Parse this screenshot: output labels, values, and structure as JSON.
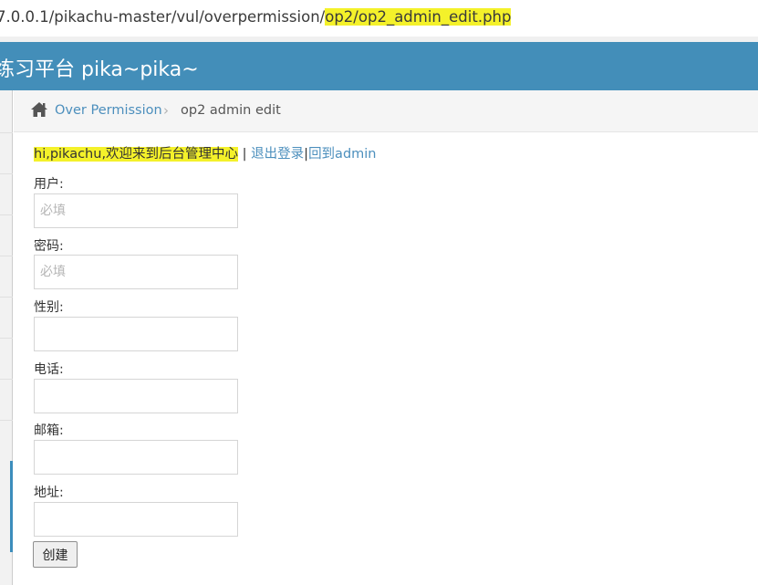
{
  "urlbar": {
    "url_prefix": "7.0.0.1/pikachu-master/vul/overpermission/",
    "url_op2": "op2/",
    "url_file": "op2_admin_edit.php"
  },
  "navbar": {
    "brand": "练习平台 pika~pika~"
  },
  "breadcrumbs": {
    "home_icon": "home-icon",
    "parent": "Over Permission",
    "separator": "›",
    "current": "op2 admin edit"
  },
  "welcome": {
    "greeting": "hi,pikachu,欢迎来到后台管理中心",
    "divider": " | ",
    "logout": "退出登录",
    "divider2": "|",
    "back": "回到admin"
  },
  "form": {
    "fields": [
      {
        "label": "用户:",
        "placeholder": "必填",
        "value": ""
      },
      {
        "label": "密码:",
        "placeholder": "必填",
        "value": ""
      },
      {
        "label": "性别:",
        "placeholder": "",
        "value": ""
      },
      {
        "label": "电话:",
        "placeholder": "",
        "value": ""
      },
      {
        "label": "邮箱:",
        "placeholder": "",
        "value": ""
      },
      {
        "label": "地址:",
        "placeholder": "",
        "value": ""
      }
    ],
    "submit_label": "创建"
  },
  "colors": {
    "navbar_bg": "#438eb9",
    "link": "#4c8fbd",
    "highlight": "#f4f12a"
  }
}
